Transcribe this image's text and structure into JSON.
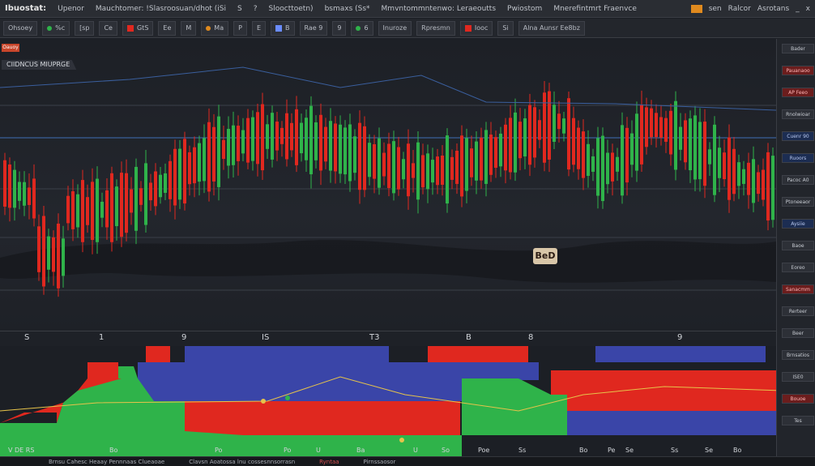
{
  "app": {
    "brand": "Ibuostat:",
    "menu": [
      "Upenor",
      "Mauchtomer: !Slasroosuan/dhot (iSi",
      "S",
      "?",
      "Sloocttoetn)",
      "bsmaxs (Ss*",
      "Mmvntommntenwo: Leraeoutts",
      "Pwiostom",
      "Mnerefintmrt Fraenvce"
    ],
    "right": [
      "sen",
      "Ralcor",
      "Asrotans",
      "_",
      "x"
    ]
  },
  "toolbar": {
    "groups": [
      "Ohsoey",
      "%c",
      "[sp",
      "Ce",
      "GtS",
      "Ee",
      "M",
      "Ma",
      "P",
      "E",
      "B",
      "Rae 9",
      "9",
      "6",
      "Inuroze",
      "Rpresmn",
      "Iooc",
      "Si",
      "Alna Aunsr Ee8bz"
    ]
  },
  "chart": {
    "title": "CIIDNCUS MIUPRGE",
    "symbol": "Oauoy",
    "price_marker": "BeD",
    "axis_labels": [
      "S",
      "1",
      "9",
      "IS",
      "T3",
      "B",
      "8",
      "9"
    ]
  },
  "sidebar": {
    "items": [
      {
        "label": "Bader",
        "style": "plain"
      },
      {
        "label": "Pauanaoo",
        "style": "red"
      },
      {
        "label": "AP Feeo",
        "style": "red"
      },
      {
        "label": "Rnolwioar",
        "style": "plain"
      },
      {
        "label": "Cuenr 90",
        "style": "blue"
      },
      {
        "label": "Ruoors",
        "style": "blue"
      },
      {
        "label": "Pacoc A0",
        "style": "plain"
      },
      {
        "label": "Ptoneeaor",
        "style": "plain"
      },
      {
        "label": "Aysiie",
        "style": "blue"
      },
      {
        "label": "Baoe",
        "style": "plain"
      },
      {
        "label": "Eoreo",
        "style": "plain"
      },
      {
        "label": "Sanacmm",
        "style": "red"
      },
      {
        "label": "Rerteer",
        "style": "plain"
      },
      {
        "label": "Beer",
        "style": "plain"
      },
      {
        "label": "Brnsatios",
        "style": "plain"
      },
      {
        "label": "ISE0",
        "style": "plain"
      },
      {
        "label": "Bouoe",
        "style": "red"
      },
      {
        "label": "Tes",
        "style": "plain"
      }
    ]
  },
  "lower": {
    "labels": [
      "V DE RS",
      "Bo",
      "Po",
      "Po",
      "U",
      "Ba",
      "U",
      "So",
      "Poe",
      "Ss",
      "Bo",
      "Pe",
      "Se",
      "Ss",
      "Se",
      "Bo"
    ]
  },
  "status": {
    "items": [
      "Brnsu Cahesc Heaay Pennnaas Clueaoae",
      "Clavsn Aoatossa lnu cossesnnsorrasn",
      "Ryntaa",
      "Pirnssaosor"
    ]
  },
  "colors": {
    "up": "#2fb34a",
    "down": "#e0281f",
    "blue_band": "#3a45a8",
    "accent": "#e08a1e"
  }
}
